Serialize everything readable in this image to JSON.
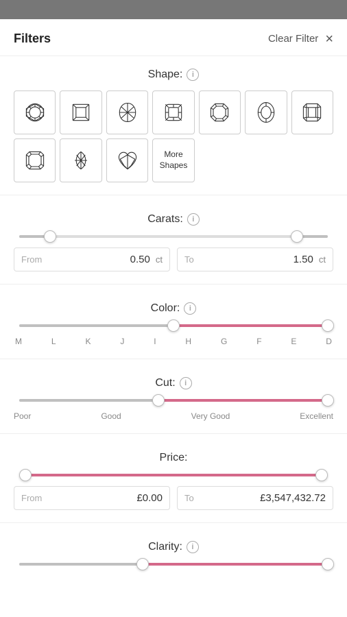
{
  "topbar": {},
  "header": {
    "title": "Filters",
    "clear_filter": "Clear Filter",
    "close": "×"
  },
  "shape_section": {
    "label": "Shape:",
    "info": "i",
    "row1": [
      {
        "name": "round",
        "label": "Round"
      },
      {
        "name": "princess",
        "label": "Princess"
      },
      {
        "name": "pear",
        "label": "Pear"
      },
      {
        "name": "cushion",
        "label": "Cushion"
      },
      {
        "name": "asscher",
        "label": "Asscher"
      },
      {
        "name": "oval",
        "label": "Oval"
      },
      {
        "name": "emerald",
        "label": "Emerald"
      }
    ],
    "row2": [
      {
        "name": "radiant",
        "label": "Radiant"
      },
      {
        "name": "marquise",
        "label": "Marquise"
      },
      {
        "name": "heart",
        "label": "Heart"
      },
      {
        "name": "more",
        "label": "More Shapes"
      }
    ]
  },
  "carats_section": {
    "label": "Carats:",
    "info": "i",
    "from_placeholder": "From",
    "from_value": "0.50",
    "from_unit": "ct",
    "to_placeholder": "To",
    "to_value": "1.50",
    "to_unit": "ct",
    "slider_left_pct": 10,
    "slider_right_pct": 90
  },
  "color_section": {
    "label": "Color:",
    "info": "i",
    "labels": [
      "M",
      "L",
      "K",
      "J",
      "I",
      "H",
      "G",
      "F",
      "E",
      "D"
    ],
    "slider_left_pct": 50,
    "slider_right_pct": 100
  },
  "cut_section": {
    "label": "Cut:",
    "info": "i",
    "labels": [
      "Poor",
      "Good",
      "Very Good",
      "Excellent"
    ],
    "slider_left_pct": 45,
    "slider_right_pct": 100
  },
  "price_section": {
    "label": "Price:",
    "from_placeholder": "From",
    "from_value": "£0.00",
    "to_placeholder": "To",
    "to_value": "£3,547,432.72",
    "slider_left_pct": 2,
    "slider_right_pct": 98
  },
  "clarity_section": {
    "label": "Clarity:",
    "info": "i",
    "slider_left_pct": 40,
    "slider_right_pct": 100
  }
}
